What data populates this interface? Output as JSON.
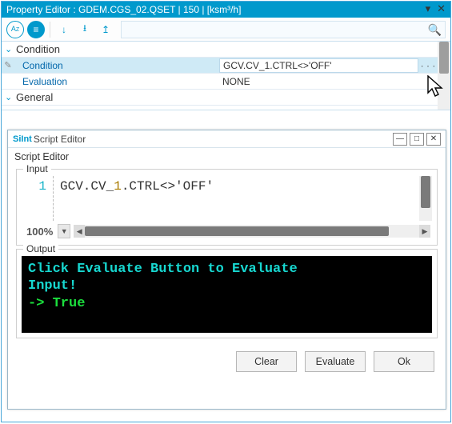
{
  "prop_editor": {
    "title": "Property Editor : GDEM.CGS_02.QSET | 150 | [ksm³/h]",
    "toolbar": {
      "sort_az": "A↓Z",
      "group": "≡",
      "down": "↓",
      "import": "⭳",
      "export": "↥",
      "search_placeholder": ""
    },
    "sections": {
      "condition": {
        "label": "Condition",
        "rows": {
          "condition": {
            "label": "Condition",
            "value": "GCV.CV_1.CTRL<>'OFF'",
            "ellipsis": "· · ·"
          },
          "evaluation": {
            "label": "Evaluation",
            "value": "NONE"
          }
        }
      },
      "general": {
        "label": "General"
      }
    }
  },
  "script_editor": {
    "brand": "SiInt",
    "title": "Script Editor",
    "subtitle": "Script Editor",
    "input": {
      "legend": "Input",
      "line_no": "1",
      "code_pre": "GCV.CV_",
      "code_num": "1",
      "code_post": ".CTRL<>'OFF'",
      "zoom": "100%"
    },
    "output": {
      "legend": "Output",
      "line1": "Click Evaluate Button to Evaluate",
      "line2": "Input!",
      "line3": "-> True"
    },
    "buttons": {
      "clear": "Clear",
      "evaluate": "Evaluate",
      "ok": "Ok"
    }
  }
}
